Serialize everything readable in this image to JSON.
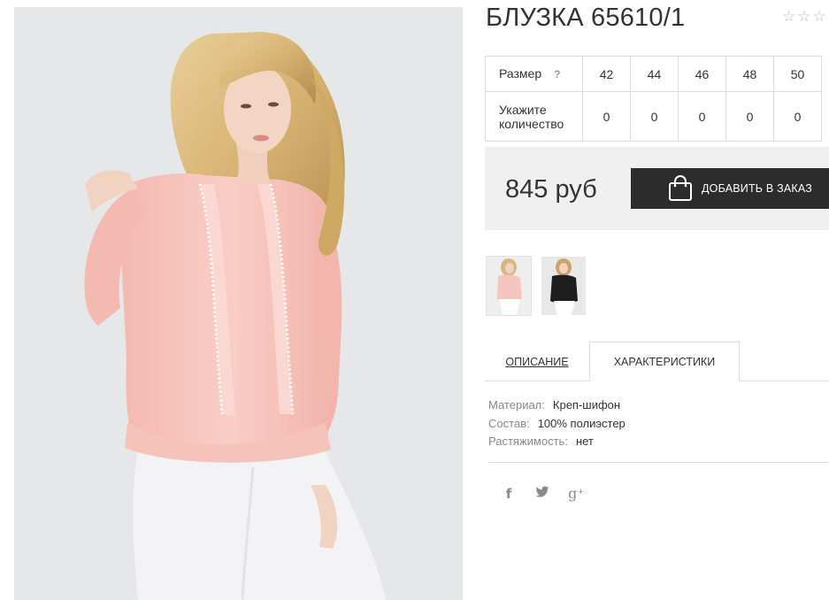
{
  "product": {
    "title": "БЛУЗКА 65610/1",
    "rating_stars": [
      "☆",
      "☆",
      "☆"
    ]
  },
  "sizes": {
    "label": "Размер",
    "help": "?",
    "qty_label": "Укажите количество",
    "columns": [
      "42",
      "44",
      "46",
      "48",
      "50"
    ],
    "quantities": [
      "0",
      "0",
      "0",
      "0",
      "0"
    ]
  },
  "buy": {
    "price": "845 руб",
    "add_to_cart": "ДОБАВИТЬ В ЗАКАЗ",
    "button_color": "#2c2c2c"
  },
  "thumbnails": [
    {
      "name": "thumbnail-pink-blouse",
      "color": "#f5c6c0"
    },
    {
      "name": "thumbnail-black-blouse",
      "color": "#1e1e1e"
    }
  ],
  "tabs": {
    "description": "ОПИСАНИЕ",
    "characteristics": "ХАРАКТЕРИСТИКИ",
    "active": "characteristics"
  },
  "characteristics": [
    {
      "key": "Материал:",
      "value": "Креп-шифон"
    },
    {
      "key": "Состав:",
      "value": "100% полиэстер"
    },
    {
      "key": "Растяжимость:",
      "value": "нет"
    }
  ],
  "social": {
    "facebook": "f",
    "twitter": "twitter-icon",
    "google_plus": "g⁺"
  },
  "colors": {
    "blouse": "#f7c5be",
    "pants": "#f4f4f6",
    "hair": "#d9b77a"
  }
}
